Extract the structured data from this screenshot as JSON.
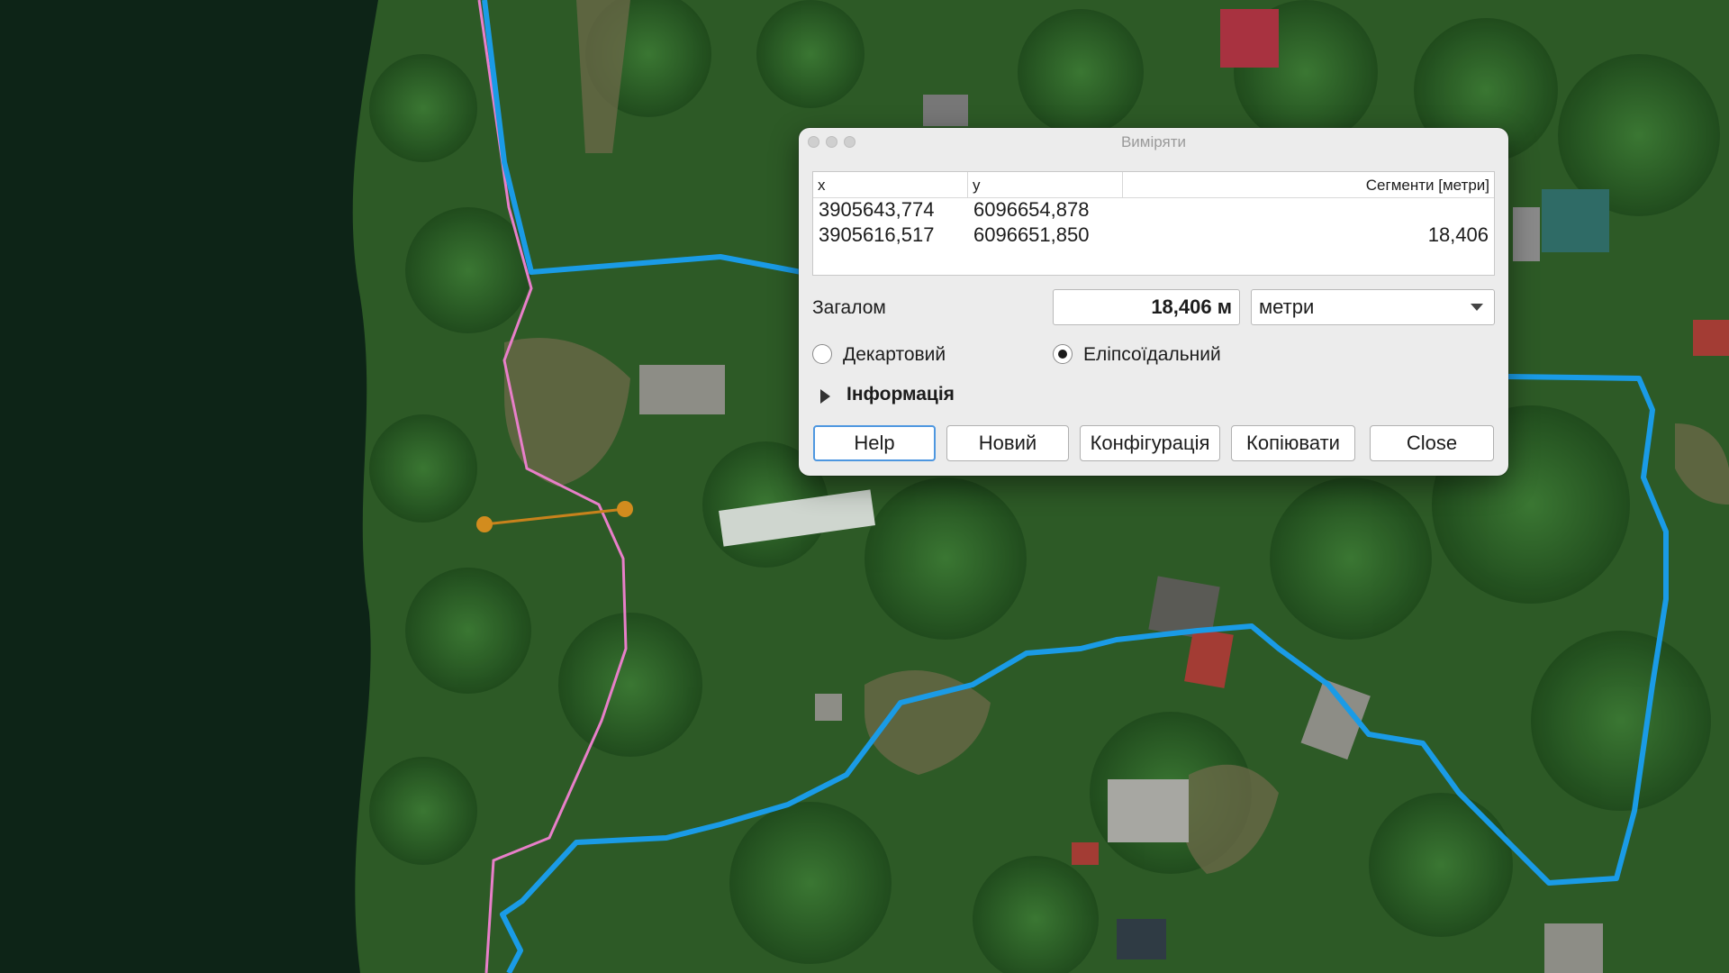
{
  "dialog": {
    "title": "Виміряти",
    "table": {
      "headers": {
        "x": "x",
        "y": "y",
        "segments": "Сегменти [метри]"
      },
      "rows": [
        {
          "x": "3905643,774",
          "y": "6096654,878",
          "segment": ""
        },
        {
          "x": "3905616,517",
          "y": "6096651,850",
          "segment": "18,406"
        }
      ]
    },
    "total_label": "Загалом",
    "total_value": "18,406 м",
    "units_selected": "метри",
    "radio_cartesian": "Декартовий",
    "radio_ellipsoidal": "Еліпсоїдальний",
    "radio_selected": "ellipsoidal",
    "info_label": "Інформація",
    "buttons": {
      "help": "Help",
      "new": "Новий",
      "config": "Конфігурація",
      "copy": "Копіювати",
      "close": "Close"
    }
  },
  "map": {
    "boundary_color": "#1a9be6",
    "river_line_color": "#e87fc9",
    "measure_line_color": "#c8821c",
    "water_color": "#0d2417"
  }
}
